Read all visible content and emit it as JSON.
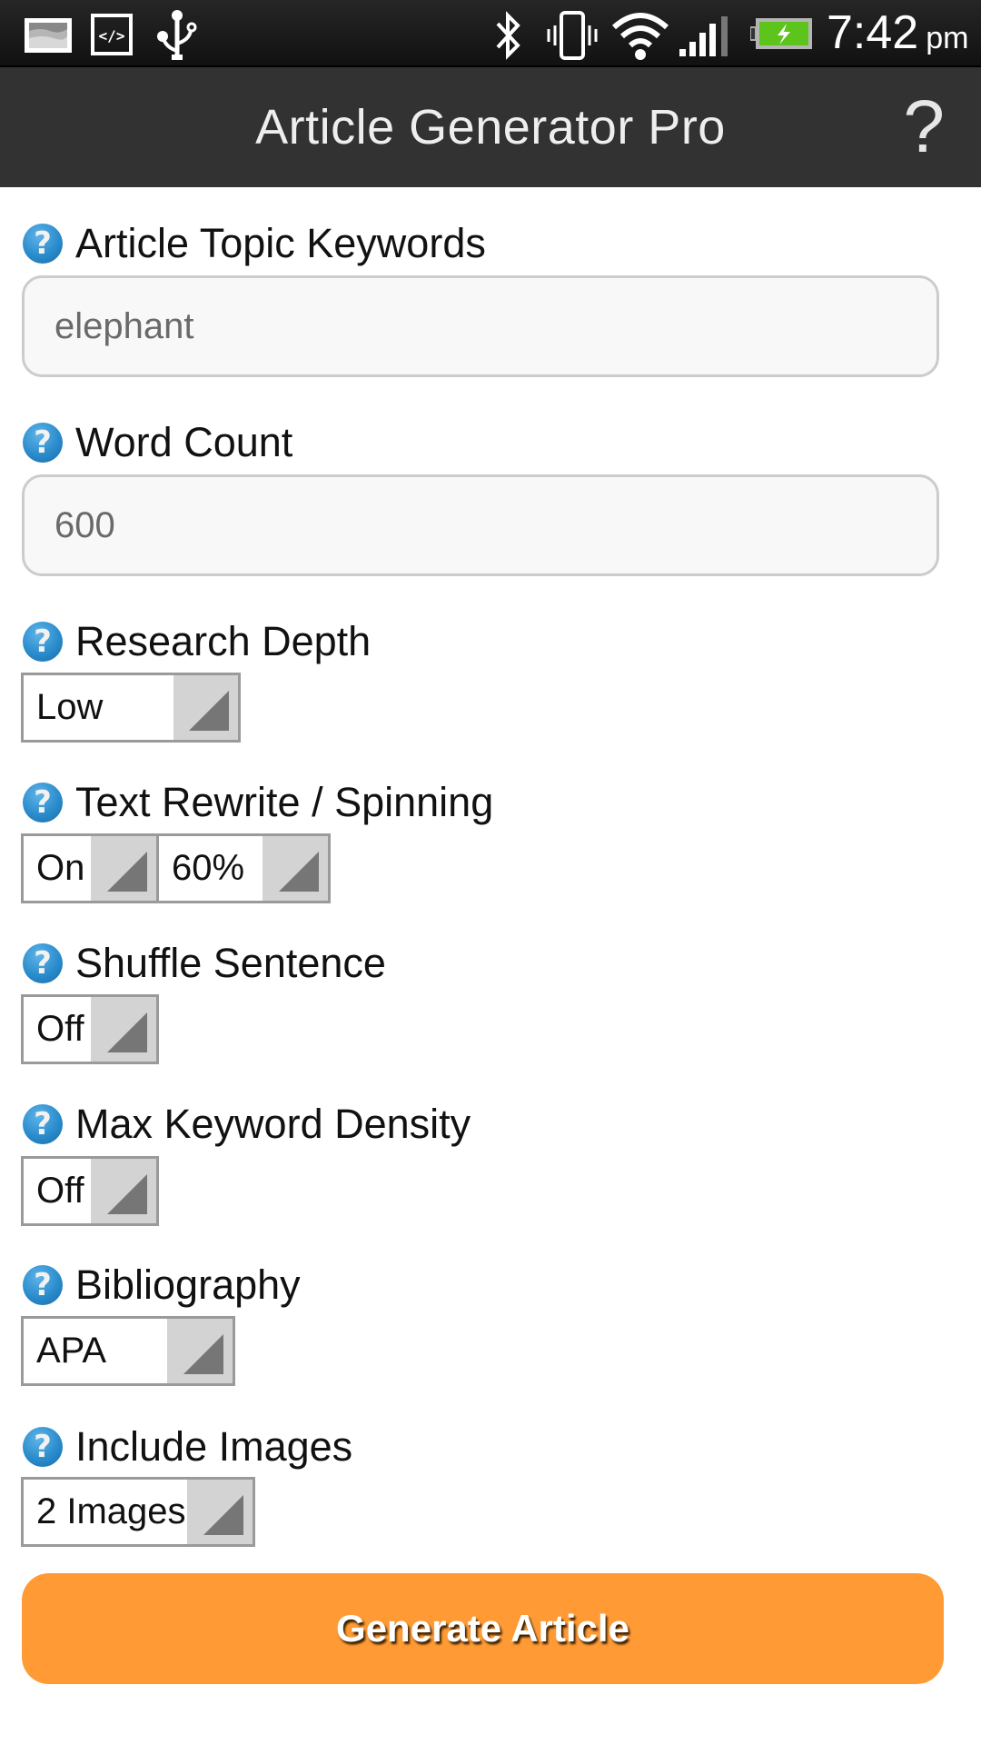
{
  "status_bar": {
    "left_icons": [
      "gallery-notification-icon",
      "developer-code-icon",
      "usb-icon"
    ],
    "right_icons": [
      "bluetooth-icon",
      "vibrate-icon",
      "wifi-icon",
      "signal-icon",
      "battery-charging-icon"
    ],
    "time": "7:42",
    "ampm": "pm",
    "colors": {
      "battery": "#5cc41a"
    }
  },
  "header": {
    "title": "Article Generator Pro",
    "help_label": "?"
  },
  "help_icon_glyph": "?",
  "fields": {
    "topic": {
      "label": "Article Topic Keywords",
      "value": "elephant"
    },
    "word_count": {
      "label": "Word Count",
      "value": "600"
    },
    "research_depth": {
      "label": "Research Depth",
      "value": "Low"
    },
    "rewrite": {
      "label": "Text Rewrite / Spinning",
      "toggle": "On",
      "percent": "60%"
    },
    "shuffle": {
      "label": "Shuffle Sentence",
      "value": "Off"
    },
    "keyword_density": {
      "label": "Max Keyword Density",
      "value": "Off"
    },
    "bibliography": {
      "label": "Bibliography",
      "value": "APA"
    },
    "images": {
      "label": "Include Images",
      "value": "2 Images"
    }
  },
  "actions": {
    "generate_label": "Generate Article"
  },
  "colors": {
    "accent": "#ff9a35",
    "header_bg": "#323232",
    "help_icon": "#2a8ccc"
  }
}
